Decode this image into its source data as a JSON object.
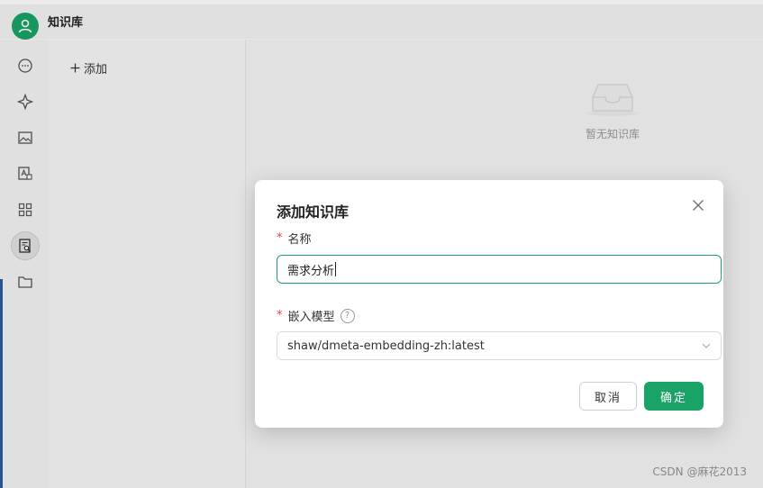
{
  "app": {
    "title": "知识库"
  },
  "sidebar": {
    "items": [
      {
        "icon": "chat-bubble-icon"
      },
      {
        "icon": "sparkle-icon"
      },
      {
        "icon": "image-icon"
      },
      {
        "icon": "translate-icon"
      },
      {
        "icon": "apps-grid-icon"
      },
      {
        "icon": "knowledge-base-icon",
        "active": true
      },
      {
        "icon": "folder-icon"
      }
    ]
  },
  "list": {
    "add_label": "添加"
  },
  "main": {
    "empty_text": "暂无知识库"
  },
  "modal": {
    "title": "添加知识库",
    "name_label": "名称",
    "name_value": "需求分析",
    "model_label": "嵌入模型",
    "model_value": "shaw/dmeta-embedding-zh:latest",
    "required_mark": "*",
    "help_mark": "?",
    "cancel_label": "取消",
    "ok_label": "确定"
  },
  "watermark": "CSDN @麻花2013",
  "colors": {
    "accent": "#1aa366",
    "required": "#e54545"
  }
}
